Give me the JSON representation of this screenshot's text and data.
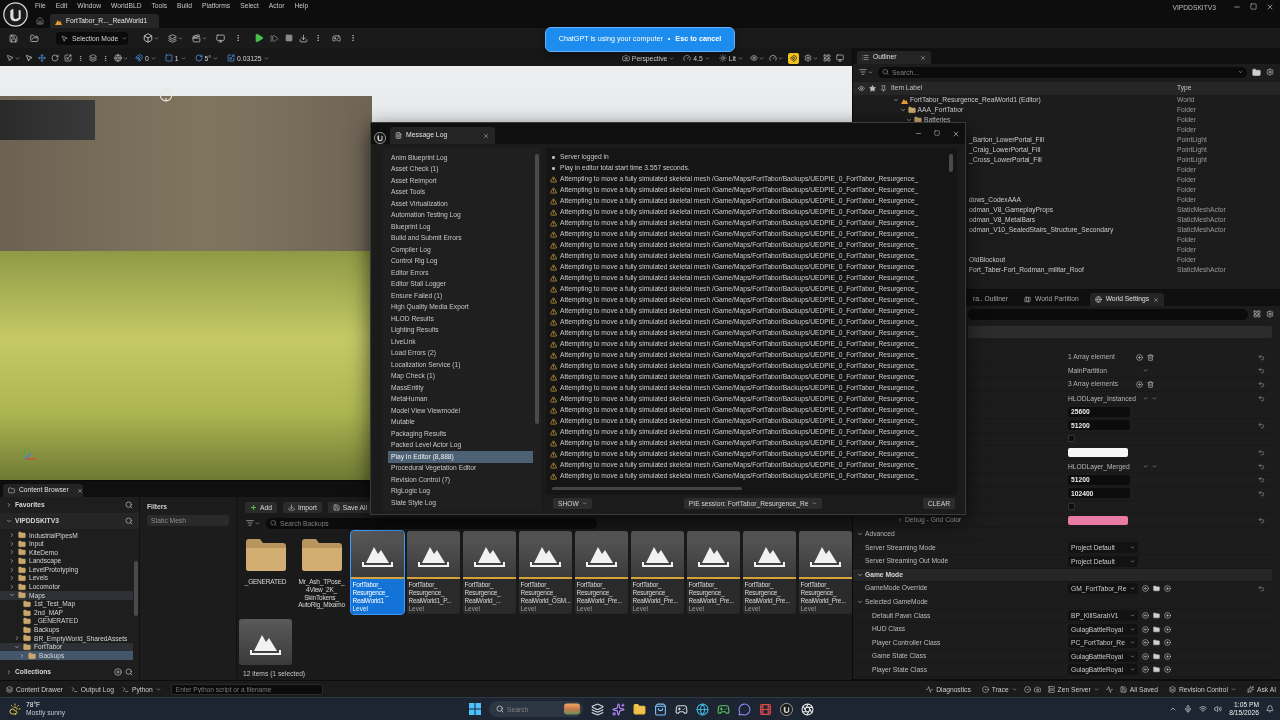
{
  "editor": {
    "menu": [
      "File",
      "Edit",
      "Window",
      "WorldBLD",
      "Tools",
      "Build",
      "Platforms",
      "Select",
      "Actor",
      "Help"
    ],
    "document_tabs": [
      {
        "label": "FortTabor_R..._RealWorld1",
        "selected": true
      }
    ],
    "project": "VIPDDSKITV3"
  },
  "toolbar": {
    "mode": "Selection Mode"
  },
  "banner": {
    "message": "ChatGPT is using your computer",
    "separator": "•",
    "action": "Esc to cancel"
  },
  "viewport": {
    "snaps": [
      {
        "kind": "surface",
        "value": "0"
      },
      {
        "kind": "grid",
        "value": "1"
      },
      {
        "kind": "rotation",
        "value": "5°"
      },
      {
        "kind": "scale",
        "value": "0.03125"
      }
    ],
    "view": [
      {
        "kind": "camera",
        "label": "Perspective"
      },
      {
        "kind": "speed",
        "label": "4.5"
      },
      {
        "kind": "lighting",
        "label": "Lit"
      }
    ]
  },
  "outliner": {
    "title": "Outliner",
    "search": {
      "placeholder": "Search..."
    },
    "columns": [
      "Item Label",
      "Type"
    ],
    "tree": [
      {
        "label": "FortTabor_Resurgence_RealWorld1 (Editor)",
        "type": "World",
        "kind": "world",
        "expanded": true,
        "children": [
          {
            "label": "AAA_FortTabor",
            "type": "Folder",
            "kind": "folder",
            "expanded": true,
            "children": [
              {
                "label": "Batteries",
                "type": "Folder",
                "kind": "folder",
                "expanded": true,
                "children": [
                  {
                    "type": "Folder",
                    "kind": "clipped"
                  },
                  {
                    "label": "_Barton_LowerPortal_Fill",
                    "type": "PointLight",
                    "kind": "clipped"
                  },
                  {
                    "label": "_Craig_LowerPortal_Fill",
                    "type": "PointLight",
                    "kind": "clipped"
                  },
                  {
                    "label": "_Cross_LowerPortal_Fill",
                    "type": "PointLight",
                    "kind": "clipped"
                  },
                  {
                    "type": "Folder",
                    "kind": "clipped"
                  },
                  {
                    "type": "Folder",
                    "kind": "clipped"
                  },
                  {
                    "type": "Folder",
                    "kind": "clipped"
                  },
                  {
                    "label": "dows_CodexAAA",
                    "type": "Folder",
                    "kind": "clipped"
                  },
                  {
                    "label": "odman_V8_GameplayProps",
                    "type": "StaticMeshActor",
                    "kind": "clipped"
                  },
                  {
                    "label": "odman_V8_MetalBars",
                    "type": "StaticMeshActor",
                    "kind": "clipped"
                  },
                  {
                    "label": "odman_V10_SealedStairs_Structure_Secondary",
                    "type": "StaticMeshActor",
                    "kind": "clipped"
                  },
                  {
                    "type": "Folder",
                    "kind": "clipped"
                  },
                  {
                    "type": "Folder",
                    "kind": "clipped"
                  },
                  {
                    "label": "OldBlockout",
                    "type": "Folder",
                    "kind": "clipped"
                  },
                  {
                    "label": "Fort_Taber-Fort_Rodman_militar_Roof",
                    "type": "StaticMeshActor",
                    "kind": "clipped"
                  }
                ]
              }
            ]
          }
        ]
      }
    ]
  },
  "details": {
    "tabs": [
      {
        "label": "ra.. Outliner",
        "kind": "clipped",
        "selected": false
      },
      {
        "label": "World Partition",
        "kind": "partition",
        "selected": false
      },
      {
        "label": "World Settings",
        "kind": "world",
        "selected": true
      }
    ],
    "rows": [
      {
        "kind": "section",
        "children": [
          {
            "kind": "array",
            "value": "1 Array element",
            "reset": true
          },
          {
            "kind": "object",
            "value": "MainPartition",
            "reset": true
          },
          {
            "kind": "array",
            "value": "3 Array elements",
            "reset": true
          },
          {
            "kind": "layer",
            "value": "HLODLayer_Instanced",
            "reset": true
          },
          {
            "kind": "number",
            "value": "25600",
            "reset": false
          },
          {
            "kind": "number",
            "value": "51200",
            "reset": true
          },
          {
            "kind": "checkbox",
            "checked": false,
            "reset": false
          },
          {
            "kind": "color",
            "color": "#f7f7f7",
            "reset": true
          },
          {
            "kind": "layer",
            "value": "HLODLayer_Merged",
            "reset": true
          },
          {
            "kind": "number",
            "value": "51200",
            "reset": true
          },
          {
            "kind": "number",
            "value": "102400",
            "reset": true
          },
          {
            "kind": "checkbox",
            "checked": false,
            "reset": false
          },
          {
            "kind": "color",
            "label": "Debug - Grid Color",
            "expanded": false,
            "color": "#e77ba3",
            "reset": true
          },
          {
            "kind": "advanced",
            "label": "Advanced",
            "expanded": true,
            "children": [
              {
                "kind": "enum",
                "label": "Server Streaming Mode",
                "value": "Project Default",
                "reset": false
              },
              {
                "kind": "enum",
                "label": "Server Streaming Out Mode",
                "value": "Project Default",
                "reset": false
              }
            ]
          }
        ]
      },
      {
        "kind": "section",
        "label": "Game Mode",
        "expanded": true,
        "children": [
          {
            "kind": "class",
            "label": "GameMode Override",
            "value": "GM_FortTabor_Re",
            "reset": true
          },
          {
            "kind": "group",
            "label": "Selected GameMode",
            "expanded": true,
            "children": [
              {
                "kind": "class",
                "label": "Default Pawn Class",
                "value": "BP_KillSarahV1",
                "reset": false
              },
              {
                "kind": "class",
                "label": "HUD Class",
                "value": "GulagBattleRoyal",
                "reset": false
              },
              {
                "kind": "class",
                "label": "Player Controller Class",
                "value": "PC_FortTabor_Re",
                "reset": false
              },
              {
                "kind": "class",
                "label": "Game State Class",
                "value": "GulagBattleRoyal",
                "reset": false
              },
              {
                "kind": "class",
                "label": "Player State Class",
                "value": "GulagBattleRoyal",
                "reset": false
              }
            ]
          }
        ]
      }
    ]
  },
  "message_log": {
    "title": "Message Log",
    "categories": [
      {
        "label": "Anim Blueprint Log",
        "selected": false
      },
      {
        "label": "Asset Check (1)",
        "selected": false
      },
      {
        "label": "Asset Reimport",
        "selected": false
      },
      {
        "label": "Asset Tools",
        "selected": false
      },
      {
        "label": "Asset Virtualization",
        "selected": false
      },
      {
        "label": "Automation Testing Log",
        "selected": false
      },
      {
        "label": "Blueprint Log",
        "selected": false
      },
      {
        "label": "Build and Submit Errors",
        "selected": false
      },
      {
        "label": "Compiler Log",
        "selected": false
      },
      {
        "label": "Control Rig Log",
        "selected": false
      },
      {
        "label": "Editor Errors",
        "selected": false
      },
      {
        "label": "Editor Stall Logger",
        "selected": false
      },
      {
        "label": "Ensure Failed (1)",
        "selected": false
      },
      {
        "label": "High Quality Media Export",
        "selected": false
      },
      {
        "label": "HLOD Results",
        "selected": false
      },
      {
        "label": "Lighting Results",
        "selected": false
      },
      {
        "label": "LiveLink",
        "selected": false
      },
      {
        "label": "Load Errors (2)",
        "selected": false
      },
      {
        "label": "Localization Service (1)",
        "selected": false
      },
      {
        "label": "Map Check (1)",
        "selected": false
      },
      {
        "label": "MassEntity",
        "selected": false
      },
      {
        "label": "MetaHuman",
        "selected": false
      },
      {
        "label": "Model View Viewmodel",
        "selected": false
      },
      {
        "label": "Mutable",
        "selected": false
      },
      {
        "label": "Packaging Results",
        "selected": false
      },
      {
        "label": "Packed Level Actor Log",
        "selected": false
      },
      {
        "label": "Play In Editor (8,888)",
        "selected": true
      },
      {
        "label": "Procedural Vegetation Editor",
        "selected": false
      },
      {
        "label": "Revision Control (7)",
        "selected": false
      },
      {
        "label": "RigLogic Log",
        "selected": false
      },
      {
        "label": "Slate Style Log",
        "selected": false
      }
    ],
    "entries": [
      {
        "kind": "info",
        "text": "Server logged in"
      },
      {
        "kind": "info",
        "text": "Play in editor total start time 3.557 seconds."
      },
      {
        "kind": "warning",
        "text": "Attempting to move a fully simulated skeletal mesh /Game/Maps/FortTabor/Backups/UEDPIE_0_FortTabor_Resurgence_"
      },
      {
        "kind": "warning",
        "text": "Attempting to move a fully simulated skeletal mesh /Game/Maps/FortTabor/Backups/UEDPIE_0_FortTabor_Resurgence_"
      },
      {
        "kind": "warning",
        "text": "Attempting to move a fully simulated skeletal mesh /Game/Maps/FortTabor/Backups/UEDPIE_0_FortTabor_Resurgence_"
      },
      {
        "kind": "warning",
        "text": "Attempting to move a fully simulated skeletal mesh /Game/Maps/FortTabor/Backups/UEDPIE_0_FortTabor_Resurgence_"
      },
      {
        "kind": "warning",
        "text": "Attempting to move a fully simulated skeletal mesh /Game/Maps/FortTabor/Backups/UEDPIE_0_FortTabor_Resurgence_"
      },
      {
        "kind": "warning",
        "text": "Attempting to move a fully simulated skeletal mesh /Game/Maps/FortTabor/Backups/UEDPIE_0_FortTabor_Resurgence_"
      },
      {
        "kind": "warning",
        "text": "Attempting to move a fully simulated skeletal mesh /Game/Maps/FortTabor/Backups/UEDPIE_0_FortTabor_Resurgence_"
      },
      {
        "kind": "warning",
        "text": "Attempting to move a fully simulated skeletal mesh /Game/Maps/FortTabor/Backups/UEDPIE_0_FortTabor_Resurgence_"
      },
      {
        "kind": "warning",
        "text": "Attempting to move a fully simulated skeletal mesh /Game/Maps/FortTabor/Backups/UEDPIE_0_FortTabor_Resurgence_"
      },
      {
        "kind": "warning",
        "text": "Attempting to move a fully simulated skeletal mesh /Game/Maps/FortTabor/Backups/UEDPIE_0_FortTabor_Resurgence_"
      },
      {
        "kind": "warning",
        "text": "Attempting to move a fully simulated skeletal mesh /Game/Maps/FortTabor/Backups/UEDPIE_0_FortTabor_Resurgence_"
      },
      {
        "kind": "warning",
        "text": "Attempting to move a fully simulated skeletal mesh /Game/Maps/FortTabor/Backups/UEDPIE_0_FortTabor_Resurgence_"
      },
      {
        "kind": "warning",
        "text": "Attempting to move a fully simulated skeletal mesh /Game/Maps/FortTabor/Backups/UEDPIE_0_FortTabor_Resurgence_"
      },
      {
        "kind": "warning",
        "text": "Attempting to move a fully simulated skeletal mesh /Game/Maps/FortTabor/Backups/UEDPIE_0_FortTabor_Resurgence_"
      },
      {
        "kind": "warning",
        "text": "Attempting to move a fully simulated skeletal mesh /Game/Maps/FortTabor/Backups/UEDPIE_0_FortTabor_Resurgence_"
      },
      {
        "kind": "warning",
        "text": "Attempting to move a fully simulated skeletal mesh /Game/Maps/FortTabor/Backups/UEDPIE_0_FortTabor_Resurgence_"
      },
      {
        "kind": "warning",
        "text": "Attempting to move a fully simulated skeletal mesh /Game/Maps/FortTabor/Backups/UEDPIE_0_FortTabor_Resurgence_"
      },
      {
        "kind": "warning",
        "text": "Attempting to move a fully simulated skeletal mesh /Game/Maps/FortTabor/Backups/UEDPIE_0_FortTabor_Resurgence_"
      },
      {
        "kind": "warning",
        "text": "Attempting to move a fully simulated skeletal mesh /Game/Maps/FortTabor/Backups/UEDPIE_0_FortTabor_Resurgence_"
      },
      {
        "kind": "warning",
        "text": "Attempting to move a fully simulated skeletal mesh /Game/Maps/FortTabor/Backups/UEDPIE_0_FortTabor_Resurgence_"
      },
      {
        "kind": "warning",
        "text": "Attempting to move a fully simulated skeletal mesh /Game/Maps/FortTabor/Backups/UEDPIE_0_FortTabor_Resurgence_"
      },
      {
        "kind": "warning",
        "text": "Attempting to move a fully simulated skeletal mesh /Game/Maps/FortTabor/Backups/UEDPIE_0_FortTabor_Resurgence_"
      },
      {
        "kind": "warning",
        "text": "Attempting to move a fully simulated skeletal mesh /Game/Maps/FortTabor/Backups/UEDPIE_0_FortTabor_Resurgence_"
      },
      {
        "kind": "warning",
        "text": "Attempting to move a fully simulated skeletal mesh /Game/Maps/FortTabor/Backups/UEDPIE_0_FortTabor_Resurgence_"
      },
      {
        "kind": "warning",
        "text": "Attempting to move a fully simulated skeletal mesh /Game/Maps/FortTabor/Backups/UEDPIE_0_FortTabor_Resurgence_"
      },
      {
        "kind": "warning",
        "text": "Attempting to move a fully simulated skeletal mesh /Game/Maps/FortTabor/Backups/UEDPIE_0_FortTabor_Resurgence_"
      },
      {
        "kind": "warning",
        "text": "Attempting to move a fully simulated skeletal mesh /Game/Maps/FortTabor/Backups/UEDPIE_0_FortTabor_Resurgence_"
      },
      {
        "kind": "warning",
        "text": "Attempting to move a fully simulated skeletal mesh /Game/Maps/FortTabor/Backups/UEDPIE_0_FortTabor_Resurgence_"
      }
    ],
    "show_button": "SHOW",
    "session": "PIE session: FortTabor_Resurgence_Re",
    "clear_button": "CLEAR"
  },
  "content_browser": {
    "title": "Content Browser",
    "roots": [
      {
        "label": "Favorites",
        "expanded": false
      },
      {
        "label": "VIPDDSKITV3",
        "expanded": true
      }
    ],
    "tree": [
      {
        "label": "IndustrialPipesM",
        "expanded": false,
        "selected": false
      },
      {
        "label": "Input",
        "expanded": false,
        "selected": false
      },
      {
        "label": "KiteDemo",
        "expanded": false,
        "selected": false
      },
      {
        "label": "Landscape",
        "expanded": false,
        "selected": false
      },
      {
        "label": "LevelPrototyping",
        "expanded": false,
        "selected": false
      },
      {
        "label": "Levels",
        "expanded": false,
        "selected": false
      },
      {
        "label": "Locomotor",
        "expanded": false,
        "selected": false
      },
      {
        "label": "Maps",
        "expanded": true,
        "selected": false,
        "children": [
          {
            "label": "1st_Test_Map",
            "selected": false
          },
          {
            "label": "2nd_MAP",
            "selected": false
          },
          {
            "label": "_GENERATED",
            "selected": false
          },
          {
            "label": "Backups",
            "selected": false
          },
          {
            "label": "BR_EmptyWorld_SharedAssets",
            "expanded": false,
            "selected": false
          },
          {
            "label": "FortTabor",
            "expanded": true,
            "selected": false,
            "children": [
              {
                "label": "Backups",
                "expanded": false,
                "selected": true
              }
            ]
          }
        ]
      }
    ],
    "collections": {
      "label": "Collections",
      "expanded": false
    },
    "filters": {
      "title": "Filters",
      "chips": [
        "Static Mesh"
      ]
    },
    "actions": [
      {
        "label": "Add",
        "kind": "add"
      },
      {
        "label": "Import",
        "kind": "import"
      },
      {
        "label": "Save All",
        "kind": "save"
      }
    ],
    "search": {
      "placeholder": "Search Backups"
    },
    "assets": [
      {
        "kind": "folder",
        "name": "_GENERATED",
        "selected": false
      },
      {
        "kind": "folder",
        "name": "Mr_Ash_TPose_4View_2K_SkinTokens_AutoRig_Mixamo",
        "selected": false
      },
      {
        "kind": "level",
        "name": "FortTabor_Resurgence_RealWorld1",
        "type": "Level",
        "selected": true
      },
      {
        "kind": "level",
        "name": "FortTabor_Resurgence_RealWorld1_P...",
        "type": "Level",
        "selected": false
      },
      {
        "kind": "level",
        "name": "FortTabor_Resurgence_RealWorld_...",
        "type": "Level",
        "selected": false
      },
      {
        "kind": "level",
        "name": "FortTabor_Resurgence_RealWorld_OSM...",
        "type": "Level",
        "selected": false
      },
      {
        "kind": "level",
        "name": "FortTabor_Resurgence_RealWorld_Pre...",
        "type": "Level",
        "selected": false
      },
      {
        "kind": "level",
        "name": "FortTabor_Resurgence_RealWorld_Pre...",
        "type": "Level",
        "selected": false
      },
      {
        "kind": "level",
        "name": "FortTabor_Resurgence_RealWorld_Pre...",
        "type": "Level",
        "selected": false
      },
      {
        "kind": "level",
        "name": "FortTabor_Resurgence_RealWorld_Pre...",
        "type": "Level",
        "selected": false
      },
      {
        "kind": "level",
        "name": "FortTabor_Resurgence_RealWorld_Pre...",
        "type": "Level",
        "selected": false
      },
      {
        "kind": "level",
        "selected": false
      }
    ],
    "summary": "12 items (1 selected)"
  },
  "status_bar": {
    "left": [
      {
        "label": "Content Drawer",
        "kind": "drawer",
        "dropdown": false
      },
      {
        "label": "Output Log",
        "kind": "log",
        "dropdown": false
      },
      {
        "label": "Python",
        "kind": "console",
        "dropdown": true
      }
    ],
    "console": {
      "placeholder": "Enter Python script or a filename"
    },
    "right": [
      {
        "label": "Diagnostics",
        "kind": "diagnostics",
        "dropdown": false
      },
      {
        "label": "Trace",
        "kind": "trace",
        "dropdown": true
      },
      {
        "label": "Zen Server",
        "kind": "server",
        "dropdown": true
      },
      {
        "label": "All Saved",
        "kind": "saved",
        "dropdown": false
      },
      {
        "label": "Revision Control",
        "kind": "revision",
        "dropdown": true
      },
      {
        "label": "Ask AI",
        "kind": "ai",
        "dropdown": false
      }
    ]
  },
  "taskbar": {
    "weather": {
      "temperature": "78°F",
      "condition": "Mostly sunny"
    },
    "search": {
      "placeholder": "Search"
    },
    "clock": {
      "time": "1:05 PM",
      "date": "8/15/2026"
    }
  }
}
